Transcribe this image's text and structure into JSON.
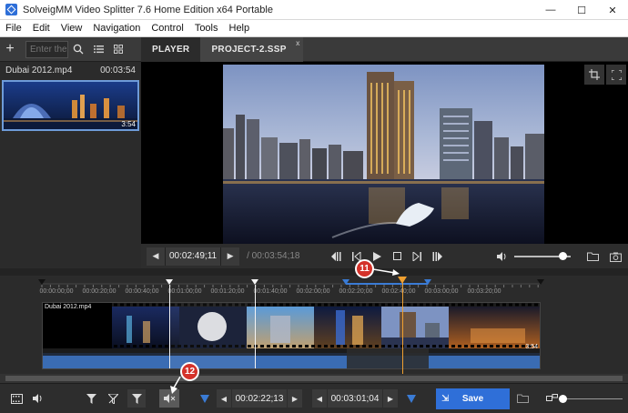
{
  "window": {
    "title": "SolveigMM Video Splitter 7.6 Home Edition x64 Portable",
    "minimize": "—",
    "maximize": "☐",
    "close": "✕"
  },
  "menu": [
    "File",
    "Edit",
    "View",
    "Navigation",
    "Control",
    "Tools",
    "Help"
  ],
  "left_panel": {
    "add_label": "+",
    "search_placeholder": "Enter the",
    "file_name": "Dubai 2012.mp4",
    "file_duration": "00:03:54",
    "thumb_duration": "3:54"
  },
  "tabs": [
    {
      "label": "PLAYER",
      "active": true
    },
    {
      "label": "PROJECT-2.SSP",
      "active": false,
      "close": "x"
    }
  ],
  "player": {
    "current_time": "00:02:49;11",
    "total_time": "/ 00:03:54;18",
    "volume": 0.85
  },
  "timeline": {
    "ticks": [
      "00:00:00;00",
      "00:00:20;00",
      "00:00:40;00",
      "00:01:00;00",
      "00:01:20;00",
      "00:01:40;00",
      "00:02:00;00",
      "00:02:20;00",
      "00:02:40;00",
      "00:03:00;00",
      "00:03:20;00"
    ],
    "track_label": "Dubai 2012.mp4",
    "track_end": "3:54"
  },
  "bottom": {
    "marker_in": "00:02:22;13",
    "marker_out": "00:03:01;04",
    "save_label": "Save"
  },
  "callouts": [
    "11",
    "12"
  ],
  "colors": {
    "accent": "#2f6fd8",
    "cursor": "#f0a030",
    "callout": "#d4322a"
  }
}
